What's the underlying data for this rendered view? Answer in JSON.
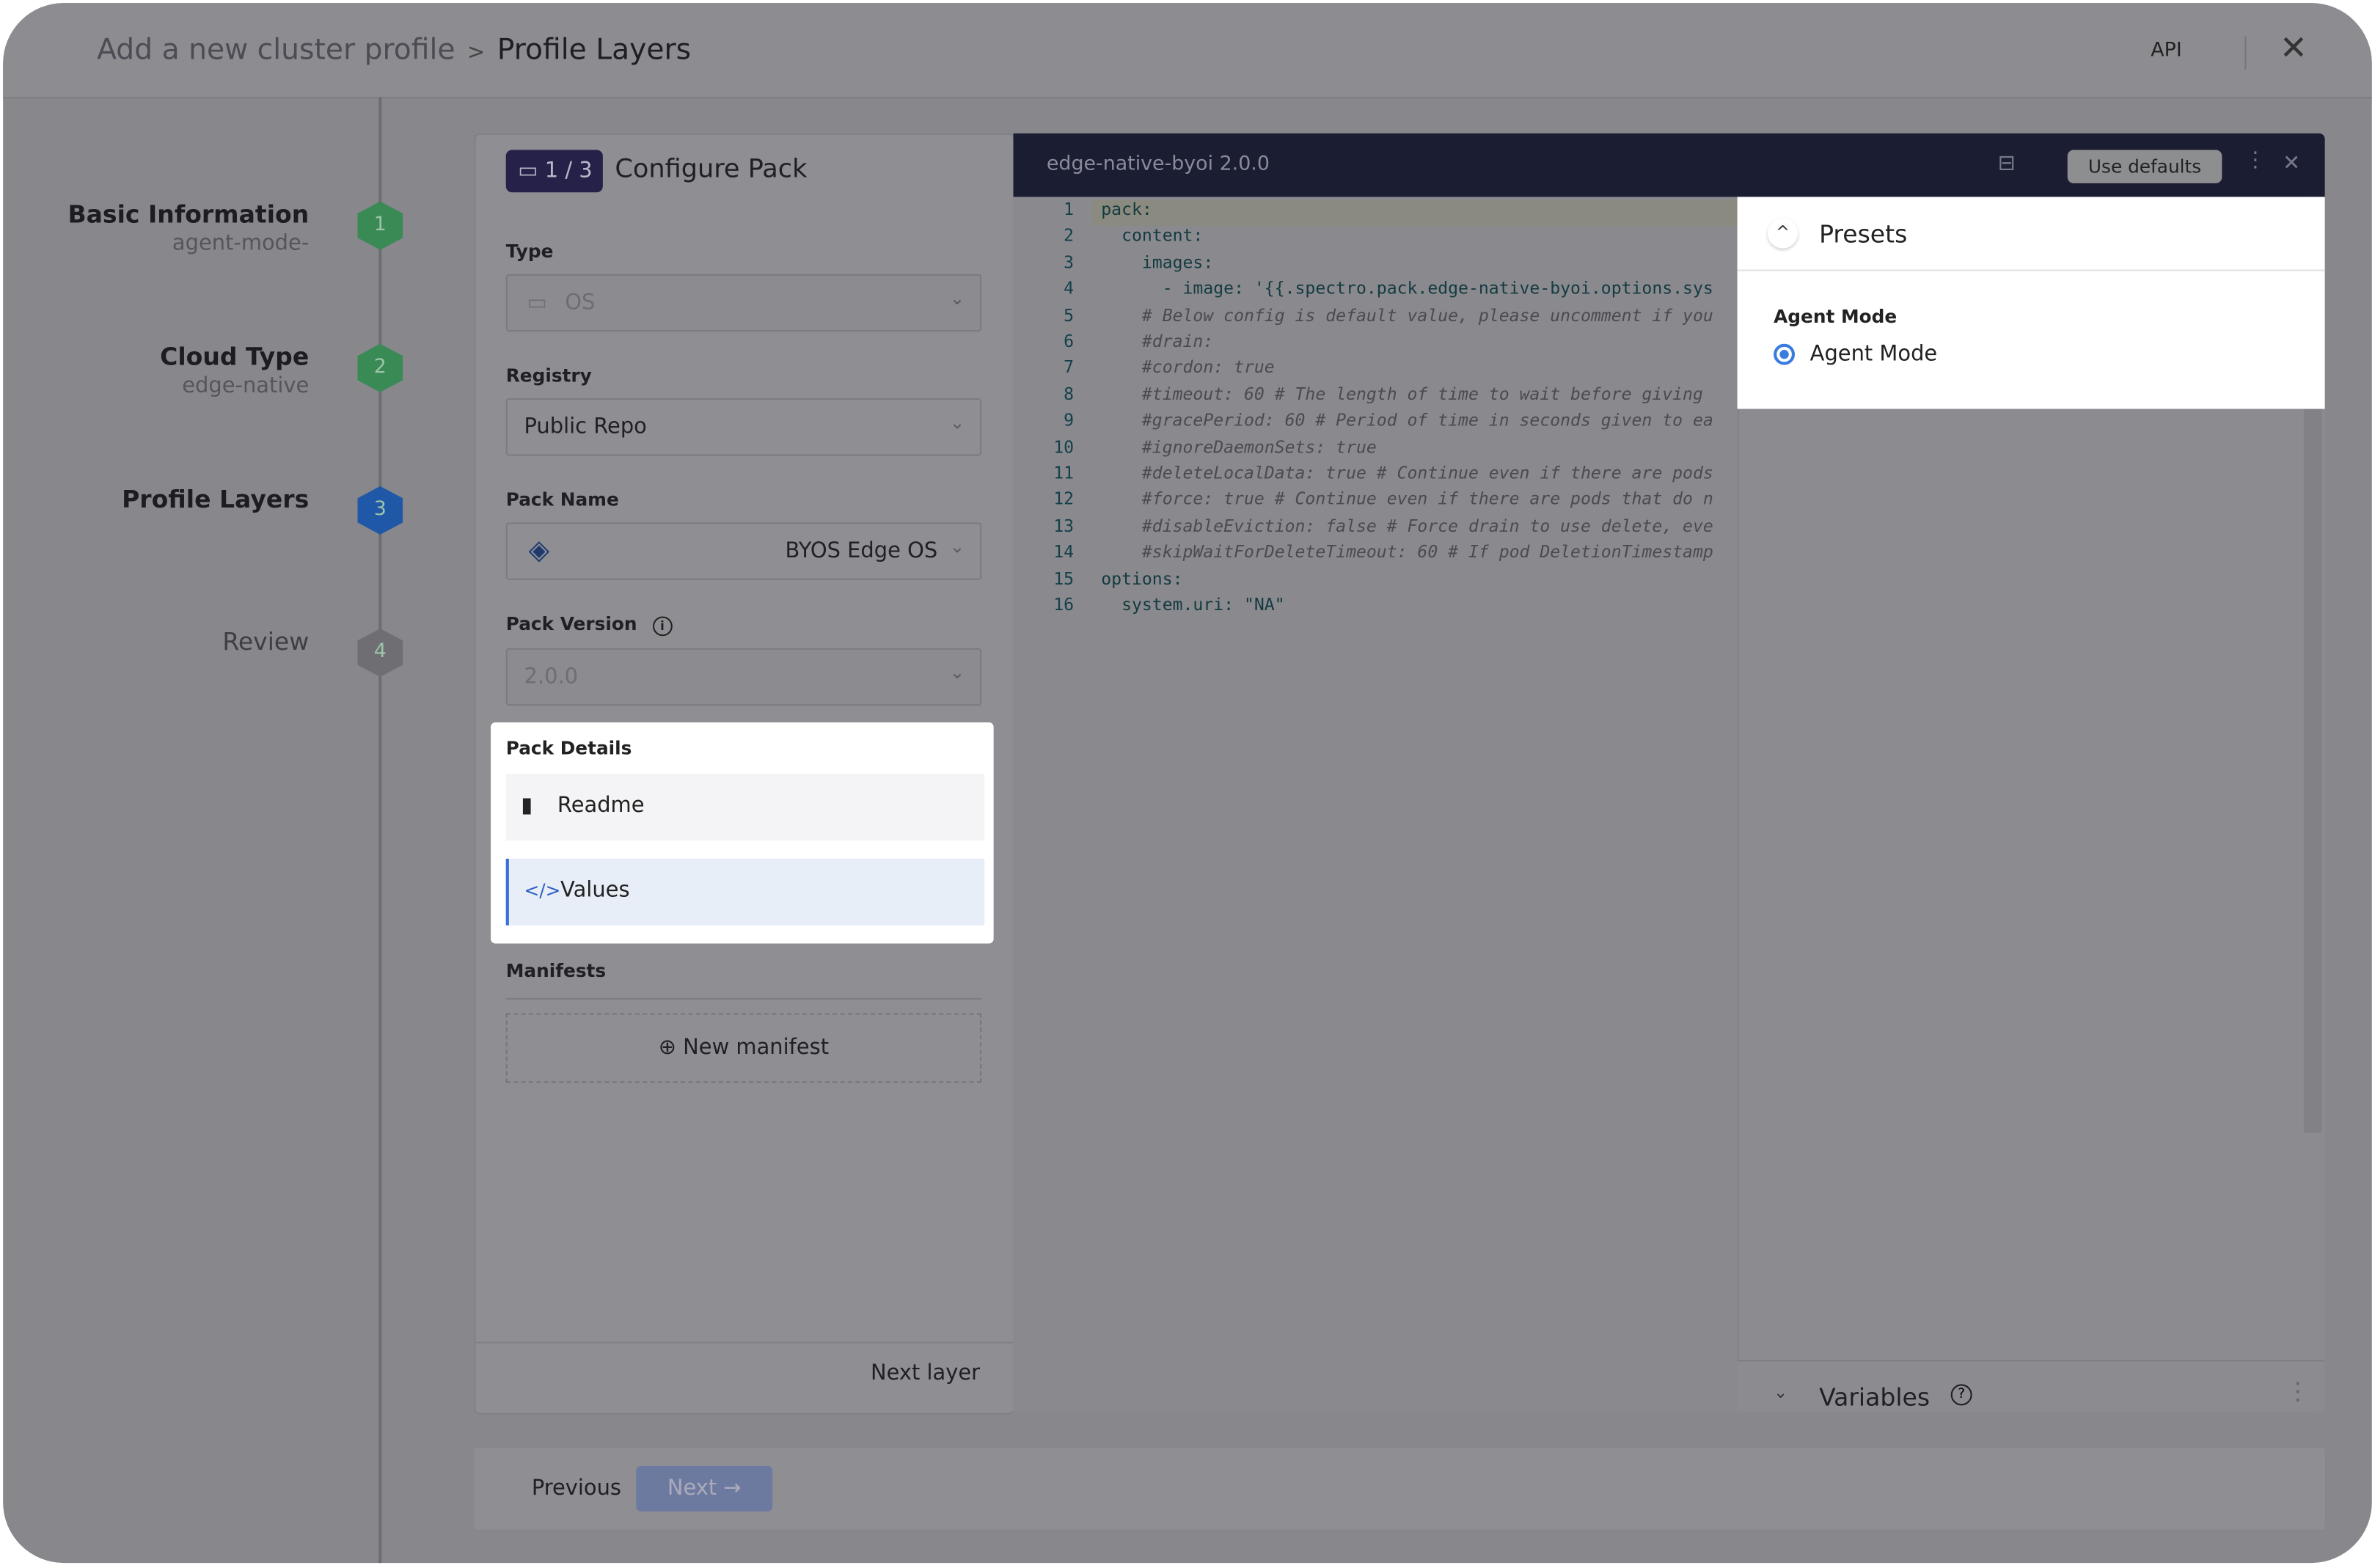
{
  "header": {
    "breadcrumb_parent": "Add a new cluster profile",
    "breadcrumb_current": "Profile Layers",
    "api_label": "API"
  },
  "steps": [
    {
      "title": "Basic Information",
      "subtitle": "agent-mode-",
      "number": "1",
      "status": "complete",
      "color": "#3a8a55"
    },
    {
      "title": "Cloud Type",
      "subtitle": "edge-native",
      "number": "2",
      "status": "complete",
      "color": "#3a8a55"
    },
    {
      "title": "Profile Layers",
      "subtitle": "",
      "number": "3",
      "status": "active",
      "color": "#2058a8"
    },
    {
      "title": "Review",
      "subtitle": "",
      "number": "4",
      "status": "pending",
      "color": "#6f6e73"
    }
  ],
  "configure": {
    "layer_counter": "1 / 3",
    "title": "Configure Pack",
    "type_label": "Type",
    "type_value": "OS",
    "registry_label": "Registry",
    "registry_value": "Public Repo",
    "pack_name_label": "Pack Name",
    "pack_name_value": "BYOS Edge OS",
    "pack_version_label": "Pack Version",
    "pack_version_value": "2.0.0",
    "pack_details_label": "Pack Details",
    "readme_label": "Readme",
    "values_label": "Values",
    "manifests_label": "Manifests",
    "new_manifest_label": "New manifest",
    "next_layer_label": "Next layer"
  },
  "editor": {
    "title": "edge-native-byoi 2.0.0",
    "use_defaults_label": "Use defaults",
    "lines": [
      {
        "n": "1",
        "text": "pack:"
      },
      {
        "n": "2",
        "text": "  content:"
      },
      {
        "n": "3",
        "text": "    images:"
      },
      {
        "n": "4",
        "text": "      - image: '{{.spectro.pack.edge-native-byoi.options.sys"
      },
      {
        "n": "5",
        "text": "    # Below config is default value, please uncomment if you"
      },
      {
        "n": "6",
        "text": "    #drain:"
      },
      {
        "n": "7",
        "text": "    #cordon: true"
      },
      {
        "n": "8",
        "text": "    #timeout: 60 # The length of time to wait before giving"
      },
      {
        "n": "9",
        "text": "    #gracePeriod: 60 # Period of time in seconds given to ea"
      },
      {
        "n": "10",
        "text": "    #ignoreDaemonSets: true"
      },
      {
        "n": "11",
        "text": "    #deleteLocalData: true # Continue even if there are pods"
      },
      {
        "n": "12",
        "text": "    #force: true # Continue even if there are pods that do n"
      },
      {
        "n": "13",
        "text": "    #disableEviction: false # Force drain to use delete, eve"
      },
      {
        "n": "14",
        "text": "    #skipWaitForDeleteTimeout: 60 # If pod DeletionTimestamp"
      },
      {
        "n": "15",
        "text": "options:"
      },
      {
        "n": "16",
        "text": "  system.uri: \"NA\""
      }
    ]
  },
  "presets": {
    "title": "Presets",
    "group_label": "Agent Mode",
    "option_label": "Agent Mode",
    "selected": true
  },
  "variables": {
    "title": "Variables"
  },
  "footer": {
    "previous_label": "Previous",
    "next_label": "Next →"
  }
}
